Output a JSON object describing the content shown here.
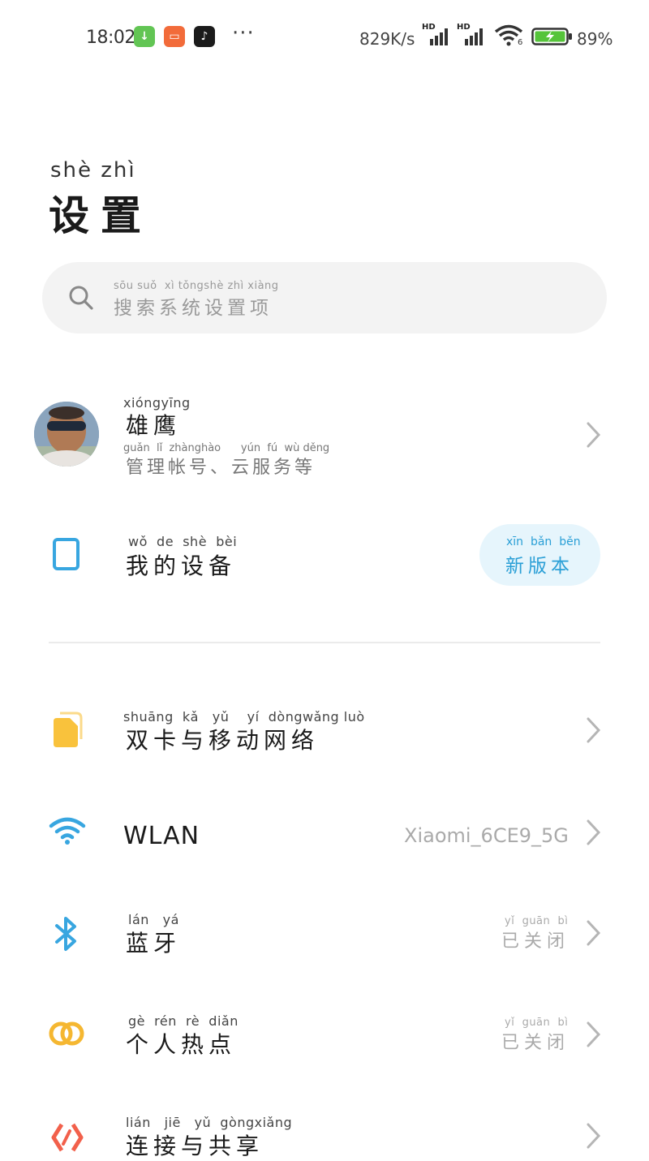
{
  "status_bar": {
    "time": "18:02",
    "more": "···",
    "speed": "829K/s",
    "hd1": "HD",
    "hd2": "HD",
    "wifi_sub": "6",
    "battery_pct": "89%",
    "app_icons": [
      "download-app-icon",
      "xiaomi-store-icon",
      "tiktok-icon"
    ]
  },
  "header": {
    "pinyin": "shè  zhì",
    "title": "设置"
  },
  "search": {
    "pinyin": "sōu suǒ  xì tǒngshè zhì xiàng",
    "placeholder": "搜索系统设置项"
  },
  "account": {
    "name_pinyin": "xióngyīng",
    "name": "雄鹰",
    "sub_pinyin": "guǎn  lǐ  zhànghào      yún  fú  wù děng",
    "sub": "管理帐号、云服务等"
  },
  "my_device": {
    "pinyin": "wǒ  de  shè  bèi",
    "label": "我的设备",
    "badge_pinyin": "xīn  bǎn  běn",
    "badge": "新版本"
  },
  "items": [
    {
      "pinyin": "shuāng  kǎ   yǔ    yí  dòngwǎng luò",
      "label": "双卡与移动网络",
      "icon": "sim-card-icon"
    },
    {
      "label": "WLAN",
      "value": "Xiaomi_6CE9_5G",
      "icon": "wifi-icon"
    },
    {
      "pinyin": "lán   yá",
      "label": "蓝牙",
      "value_pinyin": "yǐ  guān  bì",
      "value": "已关闭",
      "icon": "bluetooth-icon"
    },
    {
      "pinyin": "gè  rén  rè  diǎn",
      "label": "个人热点",
      "value_pinyin": "yǐ  guān  bì",
      "value": "已关闭",
      "icon": "hotspot-icon"
    },
    {
      "pinyin": "lián   jiē   yǔ  gòngxiǎng",
      "label": "连接与共享",
      "icon": "connection-sharing-icon"
    }
  ],
  "colors": {
    "accent_blue": "#2a9fd6",
    "sim_yellow": "#f9c23c",
    "hotspot_yellow": "#f5b731",
    "share_red": "#f2604b"
  }
}
